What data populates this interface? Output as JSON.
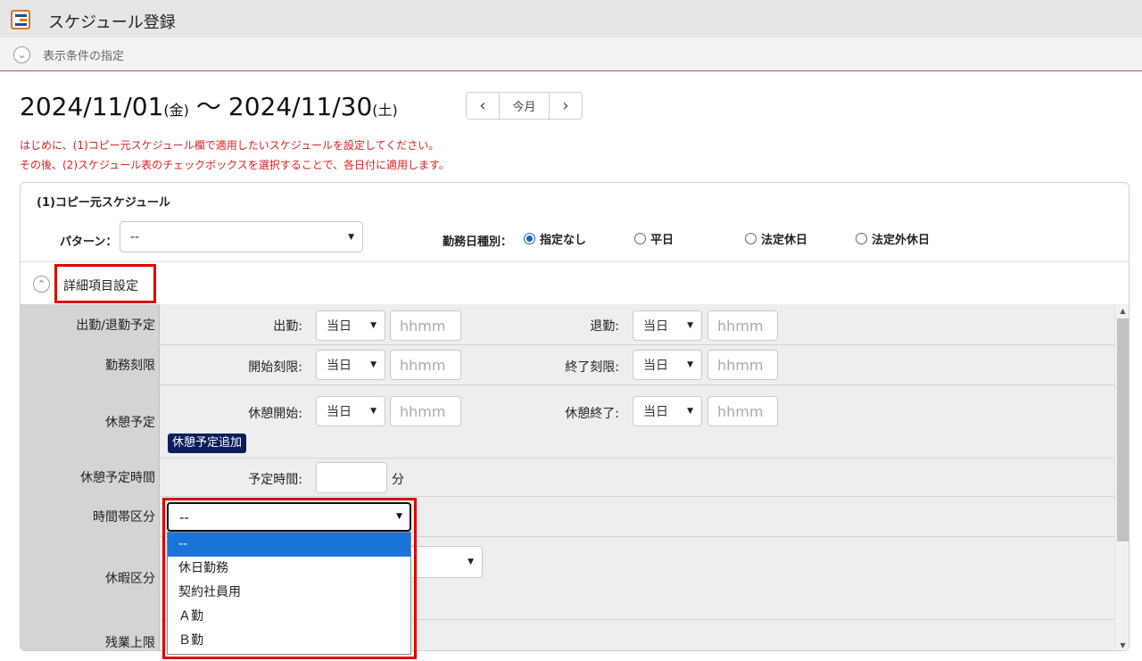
{
  "titlebar": {
    "title": "スケジュール登録",
    "icon": "schedule-app-icon"
  },
  "conditions": {
    "toggle_icon": "chevron-down-icon",
    "label": "表示条件の指定"
  },
  "period": {
    "start_date": "2024/11/01",
    "start_weekday": "(金)",
    "separator": "～",
    "end_date": "2024/11/30",
    "end_weekday": "(土)",
    "nav_today": "今月"
  },
  "messages": [
    "はじめに、(1)コピー元スケジュール欄で適用したいスケジュールを設定してください。",
    "その後、(2)スケジュール表のチェックボックスを選択することで、各日付に適用します。"
  ],
  "copy_source": {
    "title": "(1)コピー元スケジュール",
    "pattern_label": "パターン：",
    "pattern_value": "--",
    "work_type_label": "勤務日種別：",
    "work_type_options": [
      "指定なし",
      "平日",
      "法定休日",
      "法定外休日"
    ],
    "work_type_selected": "指定なし"
  },
  "detail": {
    "label": "詳細項目設定",
    "toggle_icon": "chevron-up-icon"
  },
  "rows": {
    "schedule": {
      "label": "出勤/退勤予定",
      "start_label": "出勤:",
      "start_day": "当日",
      "start_placeholder": "hhmm",
      "end_label": "退勤:",
      "end_day": "当日",
      "end_placeholder": "hhmm"
    },
    "limit": {
      "label": "勤務刻限",
      "start_label": "開始刻限:",
      "start_day": "当日",
      "start_placeholder": "hhmm",
      "end_label": "終了刻限:",
      "end_day": "当日",
      "end_placeholder": "hhmm"
    },
    "break": {
      "label": "休憩予定",
      "start_label": "休憩開始:",
      "start_day": "当日",
      "start_placeholder": "hhmm",
      "end_label": "休憩終了:",
      "end_day": "当日",
      "end_placeholder": "hhmm",
      "add_button": "休憩予定追加"
    },
    "break_time": {
      "label": "休憩予定時間",
      "field_label": "予定時間:",
      "value": "",
      "unit": "分"
    },
    "time_zone": {
      "label": "時間帯区分",
      "value": "--",
      "options": [
        "--",
        "休日勤務",
        "契約社員用",
        "Ａ勤",
        "Ｂ勤"
      ],
      "selected_index": 0
    },
    "leave": {
      "label": "休暇区分"
    },
    "overtime": {
      "label": "残業上限"
    }
  },
  "colors": {
    "highlight": "#e00000",
    "message": "#e02020",
    "add_button": "#0b1d5c",
    "selected_option": "#1a73d9",
    "radio_on": "#1565c0"
  }
}
